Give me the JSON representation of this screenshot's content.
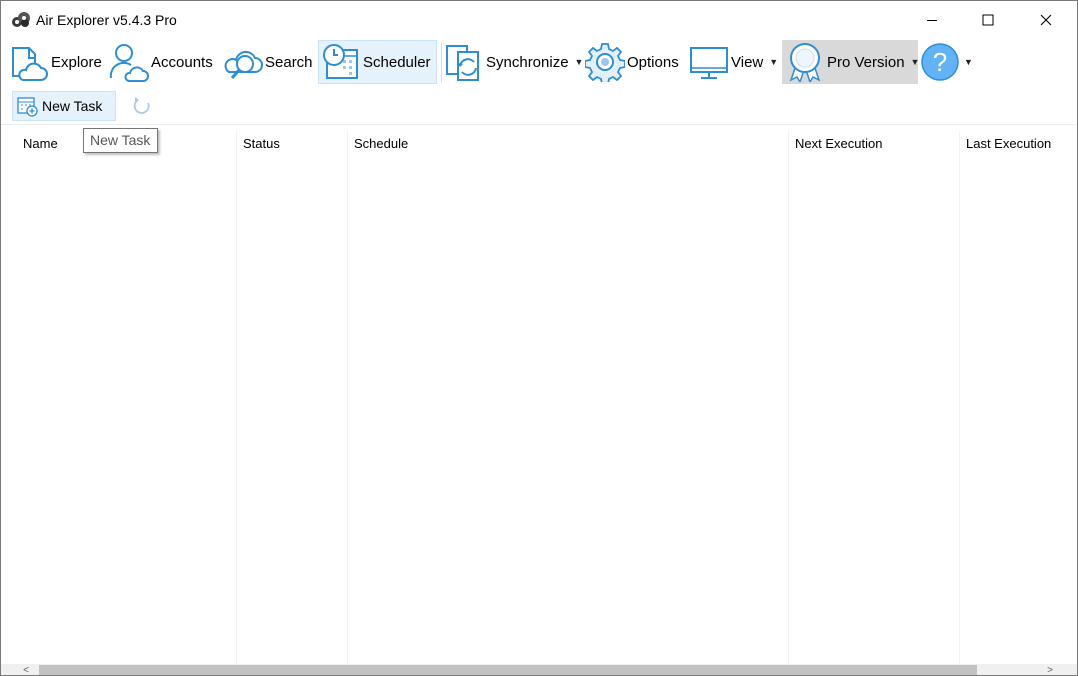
{
  "window": {
    "title": "Air Explorer v5.4.3 Pro"
  },
  "toolbar": {
    "items": [
      {
        "label": "Explore",
        "icon": "explore-cloud-icon"
      },
      {
        "label": "Accounts",
        "icon": "accounts-user-icon"
      },
      {
        "label": "Search",
        "icon": "search-cloud-icon"
      },
      {
        "label": "Scheduler",
        "icon": "scheduler-clock-icon",
        "active": true
      },
      {
        "label": "Synchronize",
        "icon": "synchronize-icon",
        "dropdown": true
      },
      {
        "label": "Options",
        "icon": "gear-icon"
      },
      {
        "label": "View",
        "icon": "monitor-icon",
        "dropdown": true
      },
      {
        "label": "Pro Version",
        "icon": "ribbon-badge-icon",
        "dropdown": true
      },
      {
        "label": "",
        "icon": "help-icon",
        "dropdown": true
      }
    ]
  },
  "subtoolbar": {
    "new_task_label": "New Task",
    "refresh_icon": "refresh-icon"
  },
  "table": {
    "columns": [
      "Name",
      "Status",
      "Schedule",
      "Next Execution",
      "Last Execution"
    ],
    "rows": []
  },
  "tooltip": {
    "text": "New Task"
  },
  "colors": {
    "accent": "#2c8ed6",
    "active_bg": "#e5f1fb",
    "pro_bg": "#d9d9d9"
  }
}
